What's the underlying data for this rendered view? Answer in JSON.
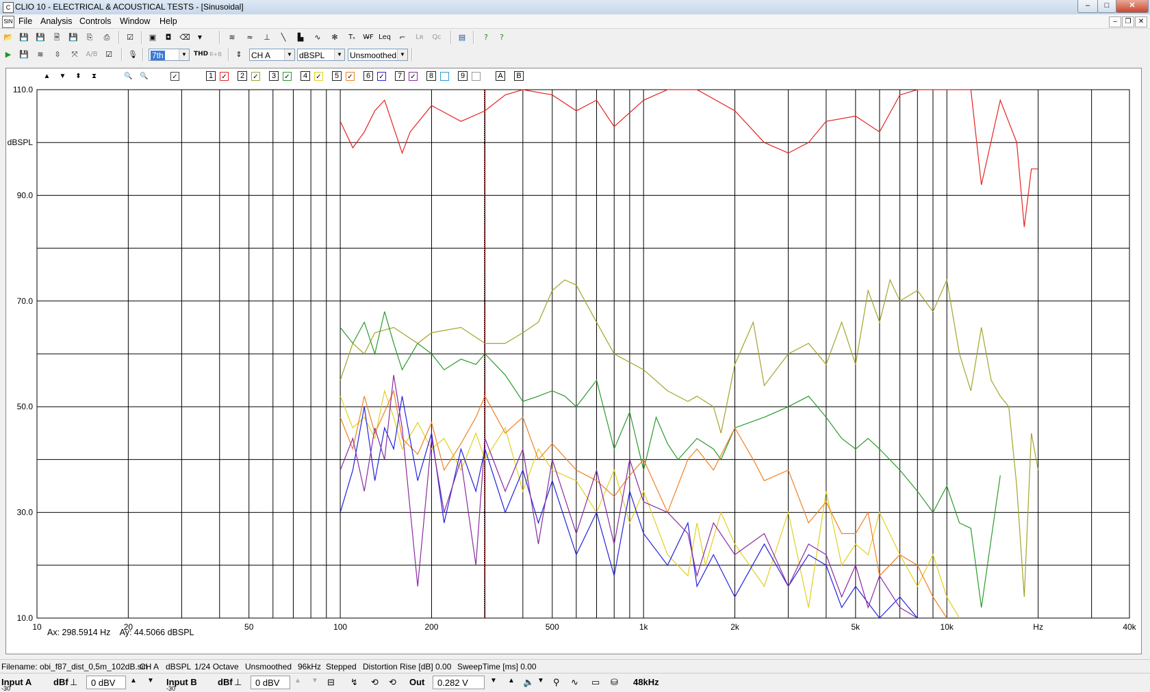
{
  "window": {
    "title": "CLIO 10 - ELECTRICAL & ACOUSTICAL TESTS - [Sinusoidal]",
    "app_icon": "clio-app-icon",
    "buttons": {
      "minimize": "‒",
      "maximize": "□",
      "close": "✕"
    }
  },
  "menu": {
    "items": [
      "File",
      "Analysis",
      "Controls",
      "Window",
      "Help"
    ],
    "mdi_icon_label": "SIN"
  },
  "toolbar2": {
    "harmonic_select": "7th",
    "thd_label": "THD",
    "rb_label": "R+B",
    "channel": "CH A",
    "unit": "dBSPL",
    "smoothing": "Unsmoothed"
  },
  "plot_controls": {
    "overlay_numbers": [
      "1",
      "2",
      "3",
      "4",
      "5",
      "6",
      "7",
      "8",
      "9"
    ],
    "overlay_checked": [
      true,
      true,
      true,
      true,
      true,
      true,
      true,
      false,
      false
    ],
    "overlay_colors": [
      "#e52222",
      "#a3a32a",
      "#2a9a2a",
      "#e0d020",
      "#f08020",
      "#2222dd",
      "#8a2aa0",
      "#2a9ad8",
      "#ffffff"
    ],
    "ab": [
      "A",
      "B"
    ]
  },
  "chart_data": {
    "type": "line",
    "title": "",
    "ylabel": "dBSPL",
    "xlabel": "Hz",
    "x_scale": "log",
    "xlim": [
      10,
      40000
    ],
    "ylim": [
      10,
      110
    ],
    "y_tick_labels": [
      "110.0",
      "dBSPL",
      "90.0",
      "",
      "70.0",
      "",
      "50.0",
      "",
      "30.0",
      "",
      "10.0"
    ],
    "x_tick_labels": [
      {
        "f": 10,
        "label": "10"
      },
      {
        "f": 20,
        "label": "20"
      },
      {
        "f": 50,
        "label": "50"
      },
      {
        "f": 100,
        "label": "100"
      },
      {
        "f": 200,
        "label": "200"
      },
      {
        "f": 500,
        "label": "500"
      },
      {
        "f": 1000,
        "label": "1k"
      },
      {
        "f": 2000,
        "label": "2k"
      },
      {
        "f": 5000,
        "label": "5k"
      },
      {
        "f": 10000,
        "label": "10k"
      },
      {
        "f": 20000,
        "label": "Hz"
      },
      {
        "f": 40000,
        "label": "40k"
      }
    ],
    "cursor_x": 298.59,
    "grid": true,
    "series": [
      {
        "color": "#e52222",
        "x": [
          100,
          110,
          120,
          130,
          140,
          160,
          170,
          200,
          250,
          300,
          350,
          400,
          500,
          600,
          700,
          800,
          1000,
          1200,
          1500,
          2000,
          2500,
          3000,
          3500,
          4000,
          5000,
          6000,
          7000,
          8000,
          10000,
          12000,
          13000,
          15000,
          17000,
          18000,
          19000,
          20000
        ],
        "y": [
          104,
          99,
          102,
          106,
          108,
          98,
          102,
          107,
          104,
          106,
          109,
          110,
          109,
          106,
          108,
          103,
          108,
          110,
          110,
          106,
          100,
          98,
          100,
          104,
          105,
          102,
          109,
          110,
          110,
          110,
          92,
          108,
          100,
          84,
          95,
          95
        ]
      },
      {
        "color": "#a3a32a",
        "x": [
          100,
          110,
          120,
          130,
          150,
          180,
          200,
          250,
          300,
          350,
          400,
          450,
          500,
          550,
          600,
          700,
          800,
          1000,
          1200,
          1400,
          1500,
          1700,
          1800,
          2000,
          2300,
          2500,
          3000,
          3500,
          4000,
          4500,
          5000,
          5500,
          6000,
          6500,
          7000,
          8000,
          9000,
          10000,
          11000,
          12000,
          13000,
          14000,
          15000,
          16000,
          17000,
          18000,
          19000,
          20000
        ],
        "y": [
          55,
          62,
          60,
          64,
          65,
          62,
          64,
          65,
          62,
          62,
          64,
          66,
          72,
          74,
          73,
          66,
          60,
          57,
          53,
          51,
          52,
          50,
          45,
          58,
          66,
          54,
          60,
          62,
          58,
          66,
          58,
          72,
          66,
          74,
          70,
          72,
          68,
          74,
          60,
          53,
          65,
          55,
          52,
          50,
          35,
          14,
          45,
          38
        ]
      },
      {
        "color": "#2a9a2a",
        "x": [
          100,
          110,
          120,
          130,
          140,
          150,
          160,
          180,
          200,
          220,
          250,
          280,
          300,
          350,
          400,
          450,
          500,
          550,
          600,
          700,
          800,
          900,
          1000,
          1100,
          1200,
          1300,
          1500,
          1700,
          1800,
          2000,
          2500,
          3000,
          3500,
          4000,
          4500,
          5000,
          5500,
          6000,
          7000,
          8000,
          9000,
          10000,
          11000,
          12000,
          13000,
          14000,
          15000
        ],
        "y": [
          65,
          62,
          66,
          60,
          68,
          62,
          57,
          62,
          60,
          57,
          59,
          58,
          60,
          56,
          51,
          52,
          53,
          52,
          50,
          55,
          42,
          49,
          38,
          48,
          43,
          40,
          44,
          42,
          40,
          46,
          48,
          50,
          52,
          48,
          44,
          42,
          44,
          42,
          38,
          34,
          30,
          35,
          28,
          27,
          12,
          25,
          37
        ]
      },
      {
        "color": "#e0d020",
        "x": [
          100,
          110,
          120,
          130,
          140,
          150,
          160,
          180,
          200,
          220,
          250,
          280,
          300,
          350,
          400,
          450,
          500,
          600,
          700,
          800,
          900,
          1000,
          1200,
          1400,
          1500,
          1600,
          1800,
          2000,
          2500,
          3000,
          3500,
          4000,
          4500,
          5000,
          5500,
          6000,
          7000,
          8000,
          9000,
          10000,
          11000
        ],
        "y": [
          52,
          46,
          48,
          44,
          53,
          48,
          42,
          47,
          42,
          44,
          38,
          45,
          40,
          46,
          34,
          42,
          38,
          36,
          30,
          38,
          28,
          34,
          22,
          18,
          28,
          20,
          30,
          24,
          16,
          30,
          12,
          34,
          20,
          24,
          22,
          30,
          22,
          16,
          22,
          14,
          10
        ]
      },
      {
        "color": "#f08020",
        "x": [
          100,
          110,
          120,
          130,
          140,
          150,
          160,
          180,
          200,
          220,
          250,
          280,
          300,
          350,
          400,
          450,
          500,
          600,
          700,
          800,
          900,
          1000,
          1200,
          1400,
          1500,
          1700,
          2000,
          2300,
          2500,
          3000,
          3500,
          4000,
          4500,
          5000,
          5500,
          6000,
          7000,
          8000,
          9000,
          10000
        ],
        "y": [
          48,
          42,
          52,
          45,
          49,
          53,
          44,
          41,
          47,
          38,
          43,
          48,
          52,
          45,
          48,
          40,
          43,
          38,
          36,
          33,
          37,
          40,
          30,
          40,
          42,
          38,
          46,
          40,
          36,
          38,
          28,
          32,
          26,
          26,
          30,
          18,
          22,
          20,
          14,
          10
        ]
      },
      {
        "color": "#2222dd",
        "x": [
          100,
          110,
          120,
          130,
          140,
          150,
          160,
          180,
          200,
          220,
          250,
          280,
          300,
          350,
          400,
          450,
          500,
          600,
          700,
          800,
          900,
          1000,
          1200,
          1400,
          1500,
          1700,
          2000,
          2500,
          3000,
          3500,
          4000,
          4500,
          5000,
          6000,
          7000,
          8000
        ],
        "y": [
          30,
          38,
          50,
          36,
          46,
          42,
          52,
          36,
          45,
          28,
          42,
          34,
          42,
          30,
          38,
          28,
          36,
          22,
          30,
          18,
          34,
          26,
          20,
          28,
          16,
          22,
          14,
          24,
          16,
          22,
          20,
          12,
          16,
          10,
          14,
          10
        ]
      },
      {
        "color": "#8a2aa0",
        "x": [
          100,
          110,
          120,
          130,
          140,
          150,
          160,
          180,
          200,
          220,
          250,
          280,
          300,
          350,
          400,
          450,
          500,
          600,
          700,
          800,
          900,
          1000,
          1200,
          1400,
          1500,
          1700,
          2000,
          2500,
          3000,
          3500,
          4000,
          4500,
          5000,
          5500,
          6000,
          7000,
          8000
        ],
        "y": [
          38,
          44,
          34,
          46,
          40,
          56,
          46,
          16,
          44,
          30,
          40,
          20,
          44,
          34,
          42,
          24,
          40,
          26,
          38,
          24,
          40,
          32,
          30,
          26,
          18,
          28,
          22,
          26,
          16,
          24,
          22,
          14,
          20,
          12,
          18,
          12,
          10
        ]
      }
    ]
  },
  "cursor_readout": {
    "ax": "Ax: 298.5914 Hz",
    "ay": "Ay: 44.5066 dBSPL"
  },
  "status": {
    "filename": "Filename: obi_f87_dist_0,5m_102dB.sin",
    "channel": "CH A",
    "unit": "dBSPL",
    "resolution": "1/24 Octave",
    "smoothing": "Unsmoothed",
    "rate": "96kHz",
    "mode": "Stepped",
    "distortion": "Distortion Rise [dB] 0.00",
    "sweep": "SweepTime [ms] 0.00"
  },
  "io_bar": {
    "input_a": "Input A",
    "input_a_unit": "dBf",
    "input_a_value": "0 dBV",
    "input_b": "Input B",
    "input_b_unit": "dBf",
    "input_b_value": "0 dBV",
    "input_b_sub": "-30",
    "input_a_sub": "-30",
    "out_label": "Out",
    "out_value": "0.282 V",
    "samplerate": "48kHz"
  }
}
